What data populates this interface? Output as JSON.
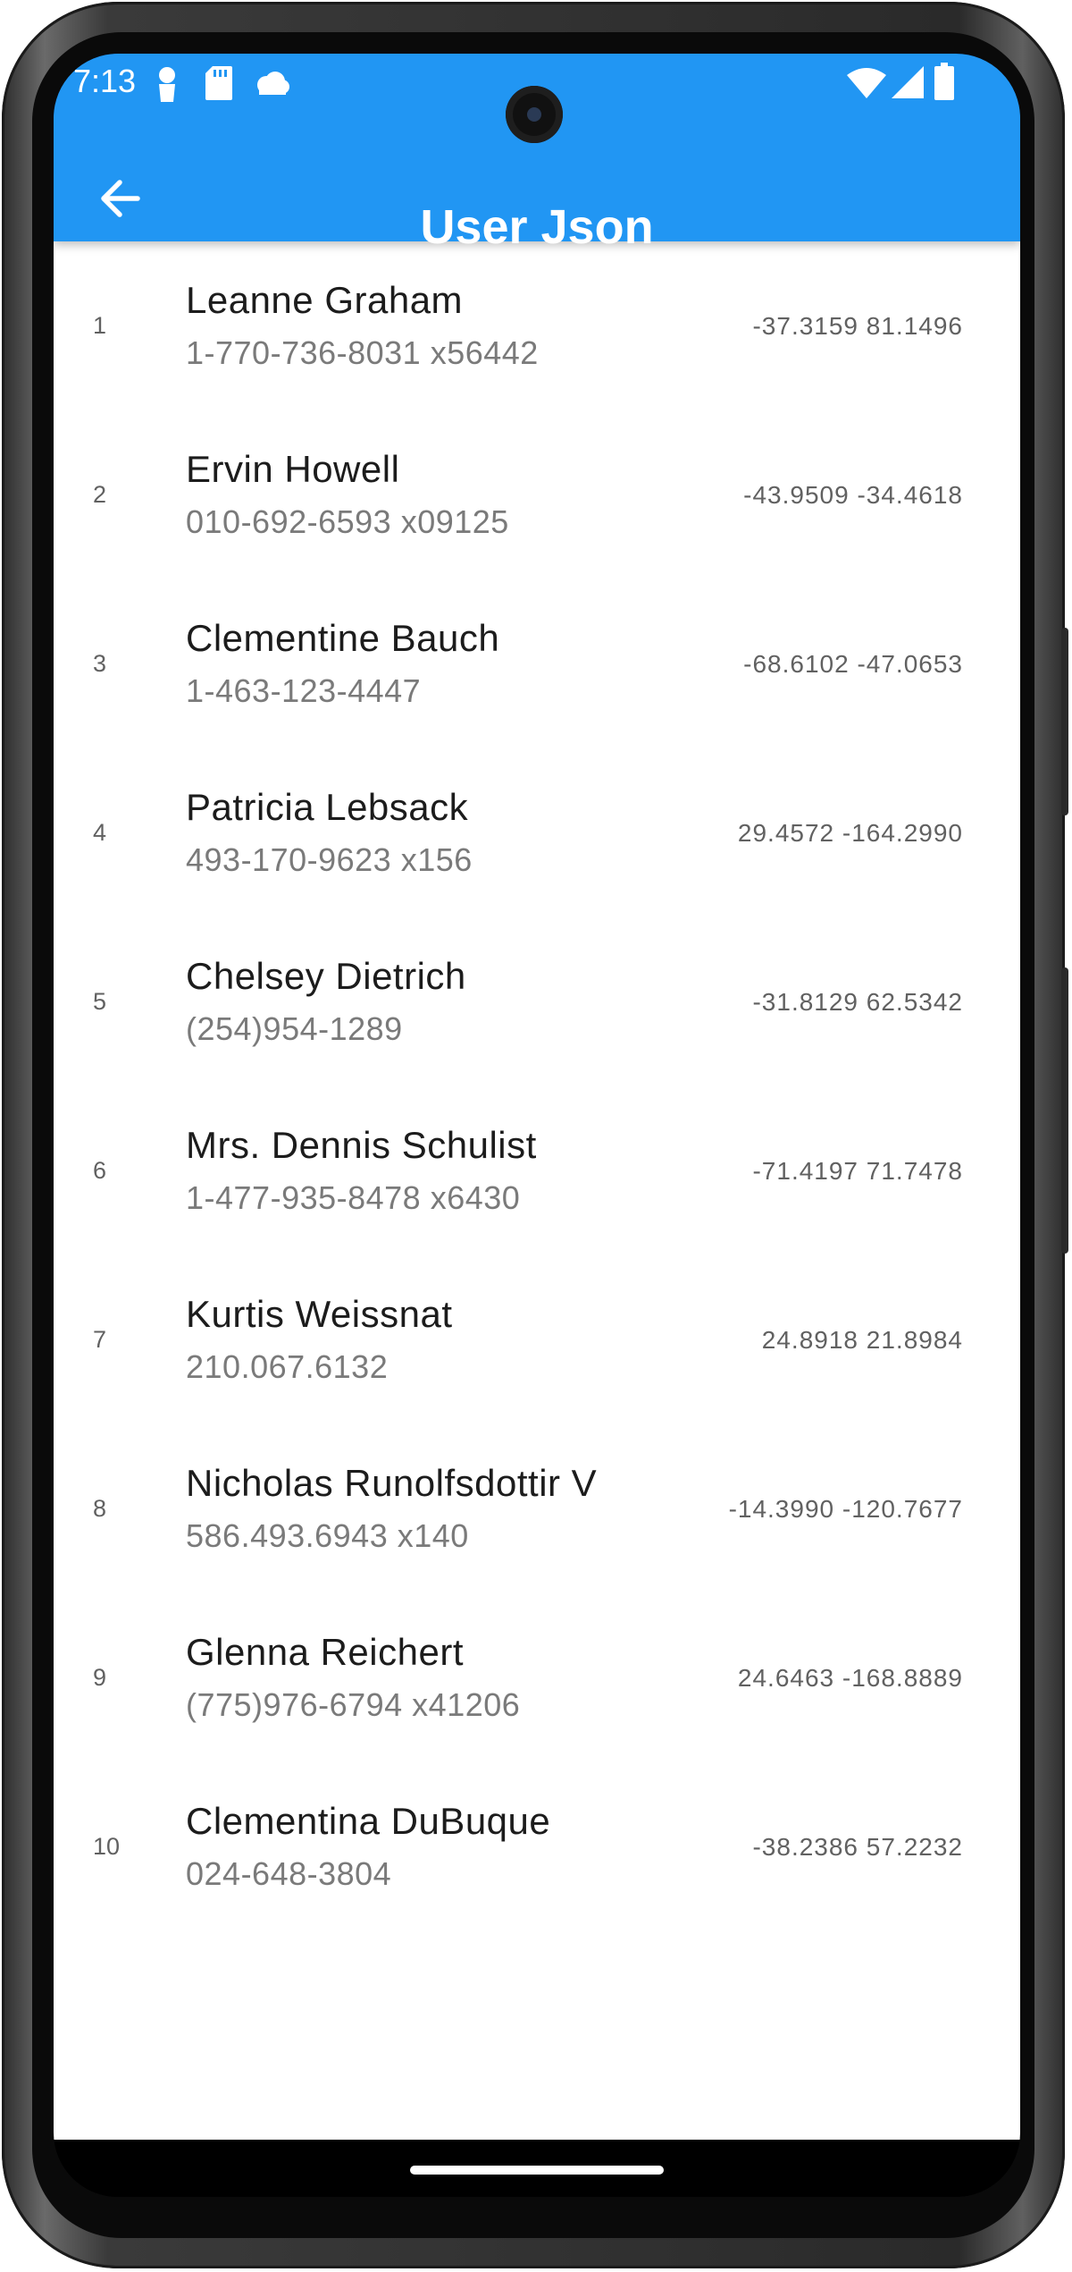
{
  "status_bar": {
    "time": "7:13",
    "left_icons": [
      "person-pin-icon",
      "sd-card-icon",
      "cloud-icon"
    ],
    "right_icons": [
      "wifi-icon",
      "cell-signal-icon",
      "battery-icon"
    ]
  },
  "app_bar": {
    "title": "User Json",
    "back_icon": "arrow-back-icon",
    "color": "#2196F3"
  },
  "users": [
    {
      "index": "1",
      "name": "Leanne Graham",
      "phone": "1-770-736-8031 x56442",
      "geo": "-37.3159 81.1496"
    },
    {
      "index": "2",
      "name": "Ervin Howell",
      "phone": "010-692-6593 x09125",
      "geo": "-43.9509 -34.4618"
    },
    {
      "index": "3",
      "name": "Clementine Bauch",
      "phone": "1-463-123-4447",
      "geo": "-68.6102 -47.0653"
    },
    {
      "index": "4",
      "name": "Patricia Lebsack",
      "phone": "493-170-9623 x156",
      "geo": "29.4572 -164.2990"
    },
    {
      "index": "5",
      "name": "Chelsey Dietrich",
      "phone": "(254)954-1289",
      "geo": "-31.8129 62.5342"
    },
    {
      "index": "6",
      "name": "Mrs. Dennis Schulist",
      "phone": "1-477-935-8478 x6430",
      "geo": "-71.4197 71.7478"
    },
    {
      "index": "7",
      "name": "Kurtis Weissnat",
      "phone": "210.067.6132",
      "geo": "24.8918 21.8984"
    },
    {
      "index": "8",
      "name": "Nicholas Runolfsdottir V",
      "phone": "586.493.6943 x140",
      "geo": "-14.3990 -120.7677"
    },
    {
      "index": "9",
      "name": "Glenna Reichert",
      "phone": "(775)976-6794 x41206",
      "geo": "24.6463 -168.8889"
    },
    {
      "index": "10",
      "name": "Clementina DuBuque",
      "phone": "024-648-3804",
      "geo": "-38.2386 57.2232"
    }
  ]
}
